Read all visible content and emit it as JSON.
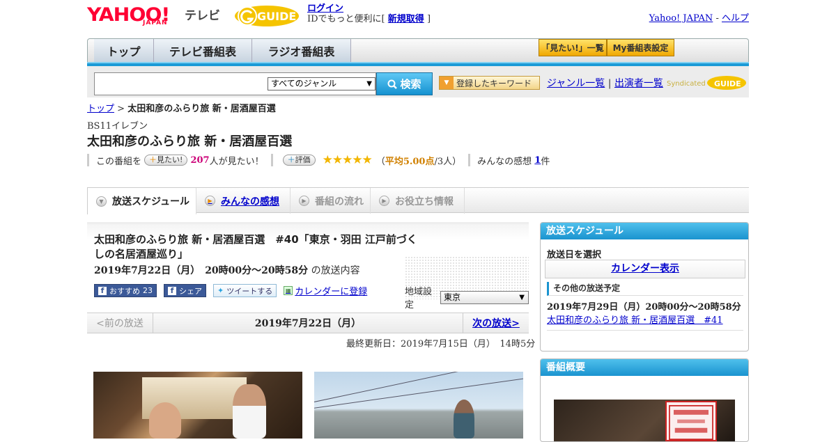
{
  "header": {
    "logo": "YAHOO!",
    "logo_sub": "JAPAN",
    "service": "テレビ",
    "login_link": "ログイン",
    "login_text_before": "IDでもっと便利に[",
    "register_link": "新規取得",
    "login_text_after": "]",
    "yahoo_japan_link": "Yahoo! JAPAN",
    "separator": "-",
    "help_link": "ヘルプ"
  },
  "nav": {
    "tabs": [
      "トップ",
      "テレビ番組表",
      "ラジオ番組表"
    ],
    "want_list_button": "「見たい!」一覧",
    "my_schedule_button": "My番組表設定"
  },
  "search": {
    "input_value": "",
    "genre_select": "すべてのジャンル",
    "search_button": "検索",
    "keyword_button": "登録したキーワード",
    "genre_list_link": "ジャンル一覧",
    "link_separator": "|",
    "performers_link": "出演者一覧",
    "syndicated_text": "Syndicated"
  },
  "breadcrumb": {
    "top": "トップ",
    "separator": ">",
    "current": "太田和彦のふらり旅 新・居酒屋百選"
  },
  "program": {
    "channel": "BS11イレブン",
    "title": "太田和彦のふらり旅 新・居酒屋百選",
    "want_prefix": "この番組を",
    "want_button": "見たい!",
    "want_count": "207",
    "want_suffix": "人が見たい！",
    "rating_button": "評価",
    "stars": "★★★★★",
    "rating_paren_open": "（",
    "rating_avg": "平均5.00点",
    "rating_count": "/3人）",
    "reviews_label": "みんなの感想",
    "reviews_count": "1",
    "reviews_suffix": "件"
  },
  "content_tabs": [
    {
      "label": "放送スケジュール",
      "state": "active"
    },
    {
      "label": "みんなの感想",
      "state": "link"
    },
    {
      "label": "番組の流れ",
      "state": "disabled"
    },
    {
      "label": "お役立ち情報",
      "state": "disabled"
    }
  ],
  "episode": {
    "title": "太田和彦のふらり旅 新・居酒屋百選　#40「東京・羽田 江戸前づくしの名居酒屋巡り」",
    "datetime": "2019年7月22日（月）　20時00分～20時58分",
    "datetime_suffix": "の放送内容",
    "fb_recommend_label": "おすすめ",
    "fb_recommend_count": "23",
    "fb_share_label": "シェア",
    "tweet_label": "ツイートする",
    "calendar_label": "カレンダーに登録",
    "area_label": "地域設定",
    "area_value": "東京"
  },
  "pager": {
    "prev": "<前の放送",
    "current": "2019年7月22日（月）",
    "next": "次の放送>"
  },
  "last_updated": "最終更新日：2019年7月15日（月）　14時5分",
  "sidebar": {
    "schedule": {
      "heading": "放送スケジュール",
      "select_date": "放送日を選択",
      "calendar_button": "カレンダー表示",
      "other_heading": "その他の放送予定",
      "next_datetime": "2019年7月29日（月）20時00分～20時58分",
      "next_title": "太田和彦のふらり旅 新・居酒屋百選　#41"
    },
    "summary": {
      "heading": "番組概要"
    }
  },
  "colors": {
    "accent_blue": "#1a93cf",
    "yahoo_red": "#ff0033",
    "star_gold": "#f2b600",
    "link": "#0000cc"
  }
}
